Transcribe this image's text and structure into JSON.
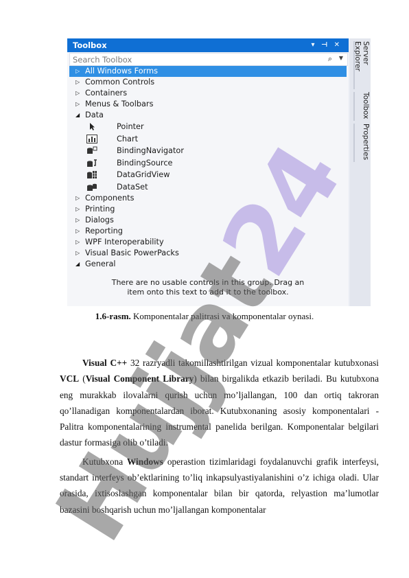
{
  "toolbox": {
    "title": "Toolbox",
    "controls": "▾ ⊣ ✕",
    "search_placeholder": "Search Toolbox",
    "groups_before": [
      {
        "label": "All Windows Forms",
        "expanded": false,
        "selected": true
      },
      {
        "label": "Common Controls",
        "expanded": false
      },
      {
        "label": "Containers",
        "expanded": false
      },
      {
        "label": "Menus & Toolbars",
        "expanded": false
      },
      {
        "label": "Data",
        "expanded": true
      }
    ],
    "data_items": [
      "Pointer",
      "Chart",
      "BindingNavigator",
      "BindingSource",
      "DataGridView",
      "DataSet"
    ],
    "groups_after": [
      {
        "label": "Components",
        "expanded": false
      },
      {
        "label": "Printing",
        "expanded": false
      },
      {
        "label": "Dialogs",
        "expanded": false
      },
      {
        "label": "Reporting",
        "expanded": false
      },
      {
        "label": "WPF Interoperability",
        "expanded": false
      },
      {
        "label": "Visual Basic PowerPacks",
        "expanded": false
      },
      {
        "label": "General",
        "expanded": true
      }
    ],
    "empty_message_line1": "There are no usable controls in this group. Drag an",
    "empty_message_line2": "item onto this text to add it to the toolbox.",
    "side_tabs": [
      "Server Explorer",
      "Toolbox",
      "Properties"
    ]
  },
  "caption": {
    "number": "1.6-rasm.",
    "text": " Komponentalar palitrasi va komponentalar oynasi."
  },
  "paragraph1": {
    "lead": "Visual C++",
    "t1": " 32 razryadli takomillashtirilgan vizual komponentalar kutubxonasi ",
    "vcl": "VCL",
    "t2": " (",
    "vcl_full": "Visual Component Library",
    "t3": ") bilan birgalikda etkazib beriladi. Bu kutubxona eng murakkab ilovalarni qurish uchun mo’ljallangan, 100 dan ortiq takroran qo’llanadigan komponentalardan iborat. Kutubxonaning asosiy komponentalari - Palitra komponentalarining instrumental panelida berilgan. Komponentalar belgilari dastur formasiga olib o’tiladi."
  },
  "paragraph2": {
    "t1": "Kutubxona ",
    "windows": "Windows",
    "t2": " operastion tizimlaridagi foydalanuvchi grafik interfeysi, standart interfeys ob’ektlarining to’liq inkapsulyastiyalanishini o’z ichiga oladi. Ular orasida, ixtisoslashgan komponentalar bilan bir qatorda, relyastion ma’lumotlar bazasini boshqarish uchun mo’ljallangan komponentalar"
  },
  "watermark": {
    "part1": "Hujjat",
    "part2": "24"
  }
}
